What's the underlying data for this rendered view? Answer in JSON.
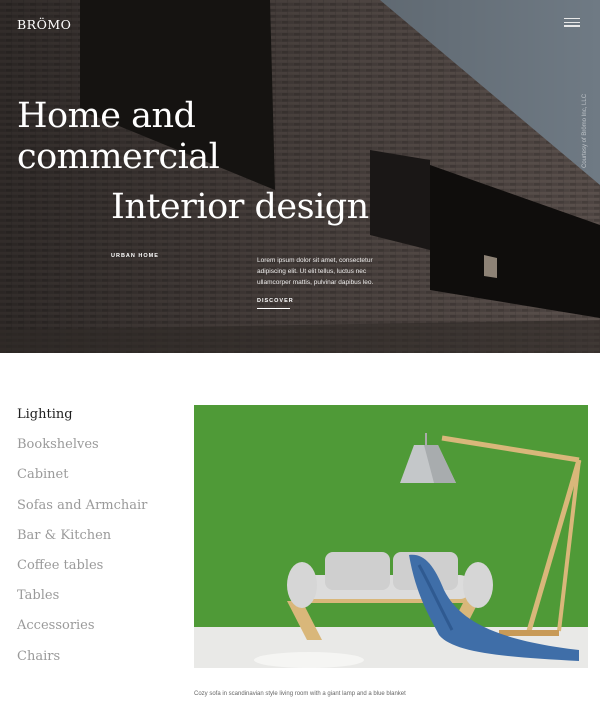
{
  "header": {
    "logo": "BRÖMO",
    "menu_icon": "hamburger-icon",
    "photo_credit": "Courtesy of Brömo Inc, LLC"
  },
  "hero": {
    "headline_line1": "Home and",
    "headline_line2": "commercial",
    "headline_line3": "Interior design",
    "tag": "URBAN HOME",
    "description": "Lorem ipsum dolor sit amet, consectetur adipiscing elit. Ut elit tellus, luctus nec ullamcorper mattis, pulvinar dapibus leo.",
    "cta": "DISCOVER"
  },
  "categories": {
    "items": [
      {
        "label": "Lighting",
        "active": true
      },
      {
        "label": "Bookshelves",
        "active": false
      },
      {
        "label": "Cabinet",
        "active": false
      },
      {
        "label": "Sofas and Armchair",
        "active": false
      },
      {
        "label": "Bar & Kitchen",
        "active": false
      },
      {
        "label": "Coffee tables",
        "active": false
      },
      {
        "label": "Tables",
        "active": false
      },
      {
        "label": "Accessories",
        "active": false
      },
      {
        "label": "Chairs",
        "active": false
      }
    ]
  },
  "featured": {
    "caption": "Cozy sofa in scandinavian style living room with a giant lamp and a blue blanket"
  },
  "colors": {
    "wall_green": "#4f9a37",
    "brick": "#4a4340",
    "text_dark": "#1f1f1f",
    "text_muted": "#9a9a9a"
  }
}
